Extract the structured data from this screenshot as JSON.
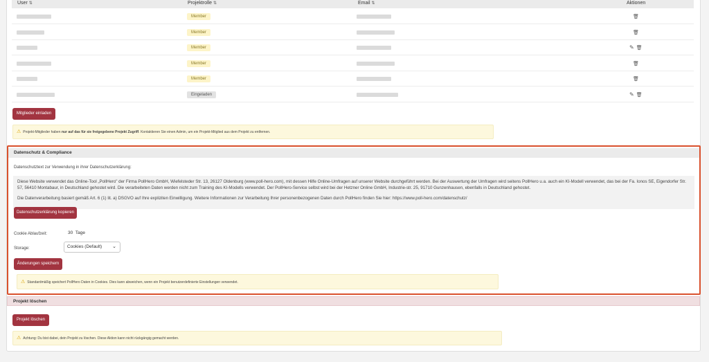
{
  "members": {
    "columns": {
      "user": "User",
      "role": "Projektrolle",
      "email": "Email",
      "actions": "Aktionen"
    },
    "sort_icon": "⇅",
    "rows": [
      {
        "role": "Member",
        "can_edit": false
      },
      {
        "role": "Member",
        "can_edit": false
      },
      {
        "role": "Member",
        "can_edit": true
      },
      {
        "role": "Member",
        "can_edit": false
      },
      {
        "role": "Member",
        "can_edit": false
      },
      {
        "role": "Eingeladen",
        "can_edit": true
      }
    ],
    "invite_button": "Mitglieder einladen",
    "notice": {
      "prefix": "Projekt-Mitglieder haben ",
      "bold": "nur auf das für sie freigegebene Projekt Zugriff",
      "suffix": ". Kontaktieren Sie einen Admin, um ein Projekt-Mitglied aus dem Projekt zu entfernen."
    }
  },
  "privacy": {
    "title": "Datenschutz & Compliance",
    "intro_label": "Datenschutztext zur Verwendung in ihrer Datenschutzerklärung:",
    "paragraph1": "Diese Website verwendet das Online-Tool „PollHero\" der Firma PollHero GmbH, Wiefelsteder Str. 13, 26127 Oldenburg (www.poll-hero.com), mit dessen Hilfe Online-Umfragen auf unserer Website durchgeführt werden. Bei der Auswertung der Umfragen wird seitens PollHero u.a. auch ein KI-Modell verwendet, das bei der Fa. Ionos SE, Eigendorfer Str. 57, 56410 Montabaur, in Deutschland gehostet wird. Die verarbeiteten Daten werden nicht zum Training des KI-Modells verwendet. Der PollHero-Service selbst wird bei der Hetzner Online GmbH, Industrie-str. 25, 91710 Gunzenhausen, ebenfalls in Deutschland gehostet.",
    "paragraph2": "Die Datenverarbeitung basiert gemäß Art. 6 (1) lit. a) DSGVO auf Ihre expliziten Einwilligung. Weitere Informationen zur Verarbeitung Ihrer personenbezogenen Daten durch PollHero finden Sie hier: https://www.poll-hero.com/datenschutz/",
    "copy_button": "Datenschutzerklärung kopieren",
    "cookie_label": "Cookie Ablaufzeit:",
    "cookie_value": "30",
    "cookie_unit": "Tage",
    "storage_label": "Storage:",
    "storage_value": "Cookies (Default)",
    "save_button": "Änderungen speichern",
    "notice": "Standardmäßig speichert PollHero Daten in Cookies. Dies kann abweichen, wenn ein Projekt benutzerdefinierte Einstellungen verwendet."
  },
  "delete": {
    "title": "Projekt löschen",
    "button": "Projekt löschen",
    "notice": "Achtung: Du bist dabei, dein Projekt zu löschen. Diese Aktion kann nicht rückgängig gemacht werden."
  },
  "icons": {
    "warning": "⚠",
    "edit": "✎",
    "trash": "🗑",
    "chevron": "⌄"
  },
  "colors": {
    "primary_button": "#a23440",
    "highlight_border": "#d9502c",
    "alert_bg": "#fdf8dd"
  }
}
